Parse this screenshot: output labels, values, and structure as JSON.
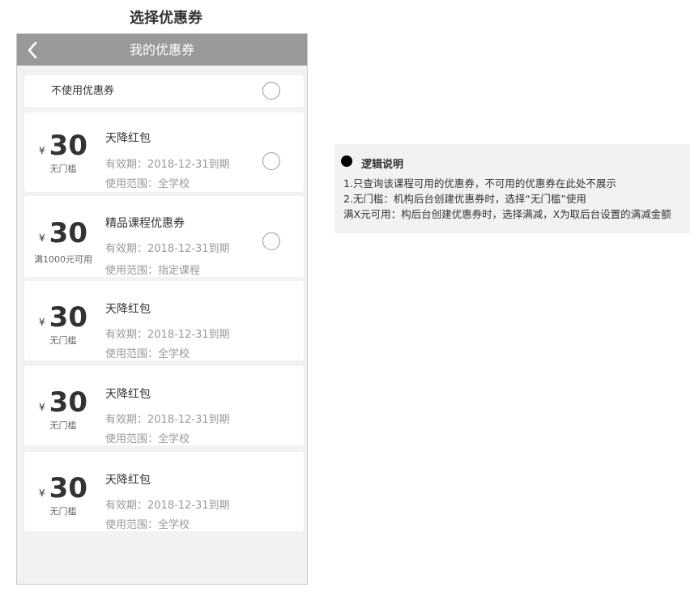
{
  "page_title": "选择优惠券",
  "navbar": {
    "title": "我的优惠券"
  },
  "no_coupon": {
    "label": "不使用优惠券"
  },
  "coupons": [
    {
      "currency": "¥",
      "amount": "30",
      "condition": "无门槛",
      "title": "天降红包",
      "valid": "有效期：2018-12-31到期",
      "scope": "使用范围：全学校",
      "selectable": true
    },
    {
      "currency": "¥",
      "amount": "30",
      "condition": "满1000元可用",
      "title": "精品课程优惠券",
      "valid": "有效期：2018-12-31到期",
      "scope": "使用范围：指定课程",
      "selectable": true
    },
    {
      "currency": "¥",
      "amount": "30",
      "condition": "无门槛",
      "title": "天降红包",
      "valid": "有效期：2018-12-31到期",
      "scope": "使用范围：全学校",
      "selectable": false
    },
    {
      "currency": "¥",
      "amount": "30",
      "condition": "无门槛",
      "title": "天降红包",
      "valid": "有效期：2018-12-31到期",
      "scope": "使用范围：全学校",
      "selectable": false
    },
    {
      "currency": "¥",
      "amount": "30",
      "condition": "无门槛",
      "title": "天降红包",
      "valid": "有效期：2018-12-31到期",
      "scope": "使用范围：全学校",
      "selectable": false
    }
  ],
  "logic": {
    "title": "逻辑说明",
    "lines": [
      "1.只查询该课程可用的优惠券，不可用的优惠券在此处不展示",
      "2.无门槛：机构后台创建优惠券时，选择“无门槛”使用",
      "满X元可用：构后台创建优惠券时，选择满减，X为取后台设置的满减金额"
    ]
  },
  "colors": {
    "navbar": "#999999",
    "phone_bg": "#f2f2f2",
    "card_bg": "#ffffff",
    "secondary_text": "#999999"
  }
}
